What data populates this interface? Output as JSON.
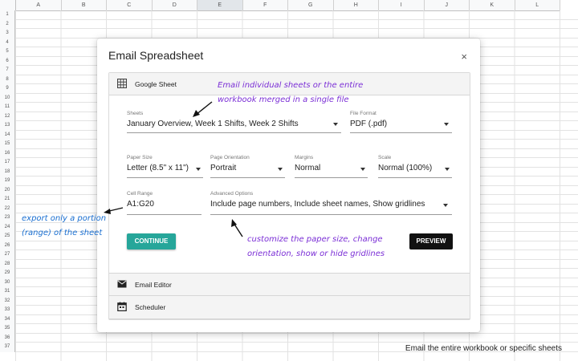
{
  "sheet": {
    "columns": [
      "A",
      "B",
      "C",
      "D",
      "E",
      "F",
      "G",
      "H",
      "I",
      "J",
      "K",
      "L"
    ],
    "selected_column": "E",
    "rows": [
      "1",
      "2",
      "3",
      "4",
      "5",
      "6",
      "7",
      "8",
      "9",
      "10",
      "11",
      "12",
      "13",
      "14",
      "15",
      "16",
      "17",
      "18",
      "19",
      "20",
      "21",
      "22",
      "23",
      "24",
      "25",
      "26",
      "27",
      "28",
      "29",
      "30",
      "31",
      "32",
      "33",
      "34",
      "35",
      "36",
      "37"
    ]
  },
  "dialog": {
    "title": "Email Spreadsheet",
    "close_label": "×",
    "sections": {
      "google_sheet": "Google Sheet",
      "email_editor": "Email Editor",
      "scheduler": "Scheduler"
    },
    "fields": {
      "sheets": {
        "label": "Sheets",
        "value": "January Overview, Week 1 Shifts, Week 2 Shifts"
      },
      "file_format": {
        "label": "File Format",
        "value": "PDF (.pdf)"
      },
      "paper_size": {
        "label": "Paper Size",
        "value": "Letter (8.5\" x 11\")"
      },
      "page_orientation": {
        "label": "Page Orientation",
        "value": "Portrait"
      },
      "margins": {
        "label": "Margins",
        "value": "Normal"
      },
      "scale": {
        "label": "Scale",
        "value": "Normal (100%)"
      },
      "cell_range": {
        "label": "Cell Range",
        "value": "A1:G20"
      },
      "advanced_options": {
        "label": "Advanced Options",
        "value": "Include page numbers, Include sheet names, Show gridlines"
      }
    },
    "buttons": {
      "continue": "CONTINUE",
      "preview": "PREVIEW"
    }
  },
  "annotations": {
    "top_line1": "Email individual sheets or the entire",
    "top_line2": "workbook merged in a single file",
    "left_line1": "export only a portion",
    "left_line2": "(range) of the sheet",
    "bottom_line1": "customize the paper size, change",
    "bottom_line2": "orientation, show or hide gridlines",
    "caption": "Email the entire workbook or specific sheets"
  },
  "colors": {
    "accent": "#26a69a",
    "annotation_purple": "#7b2fd6",
    "annotation_blue": "#1a6fd1"
  }
}
